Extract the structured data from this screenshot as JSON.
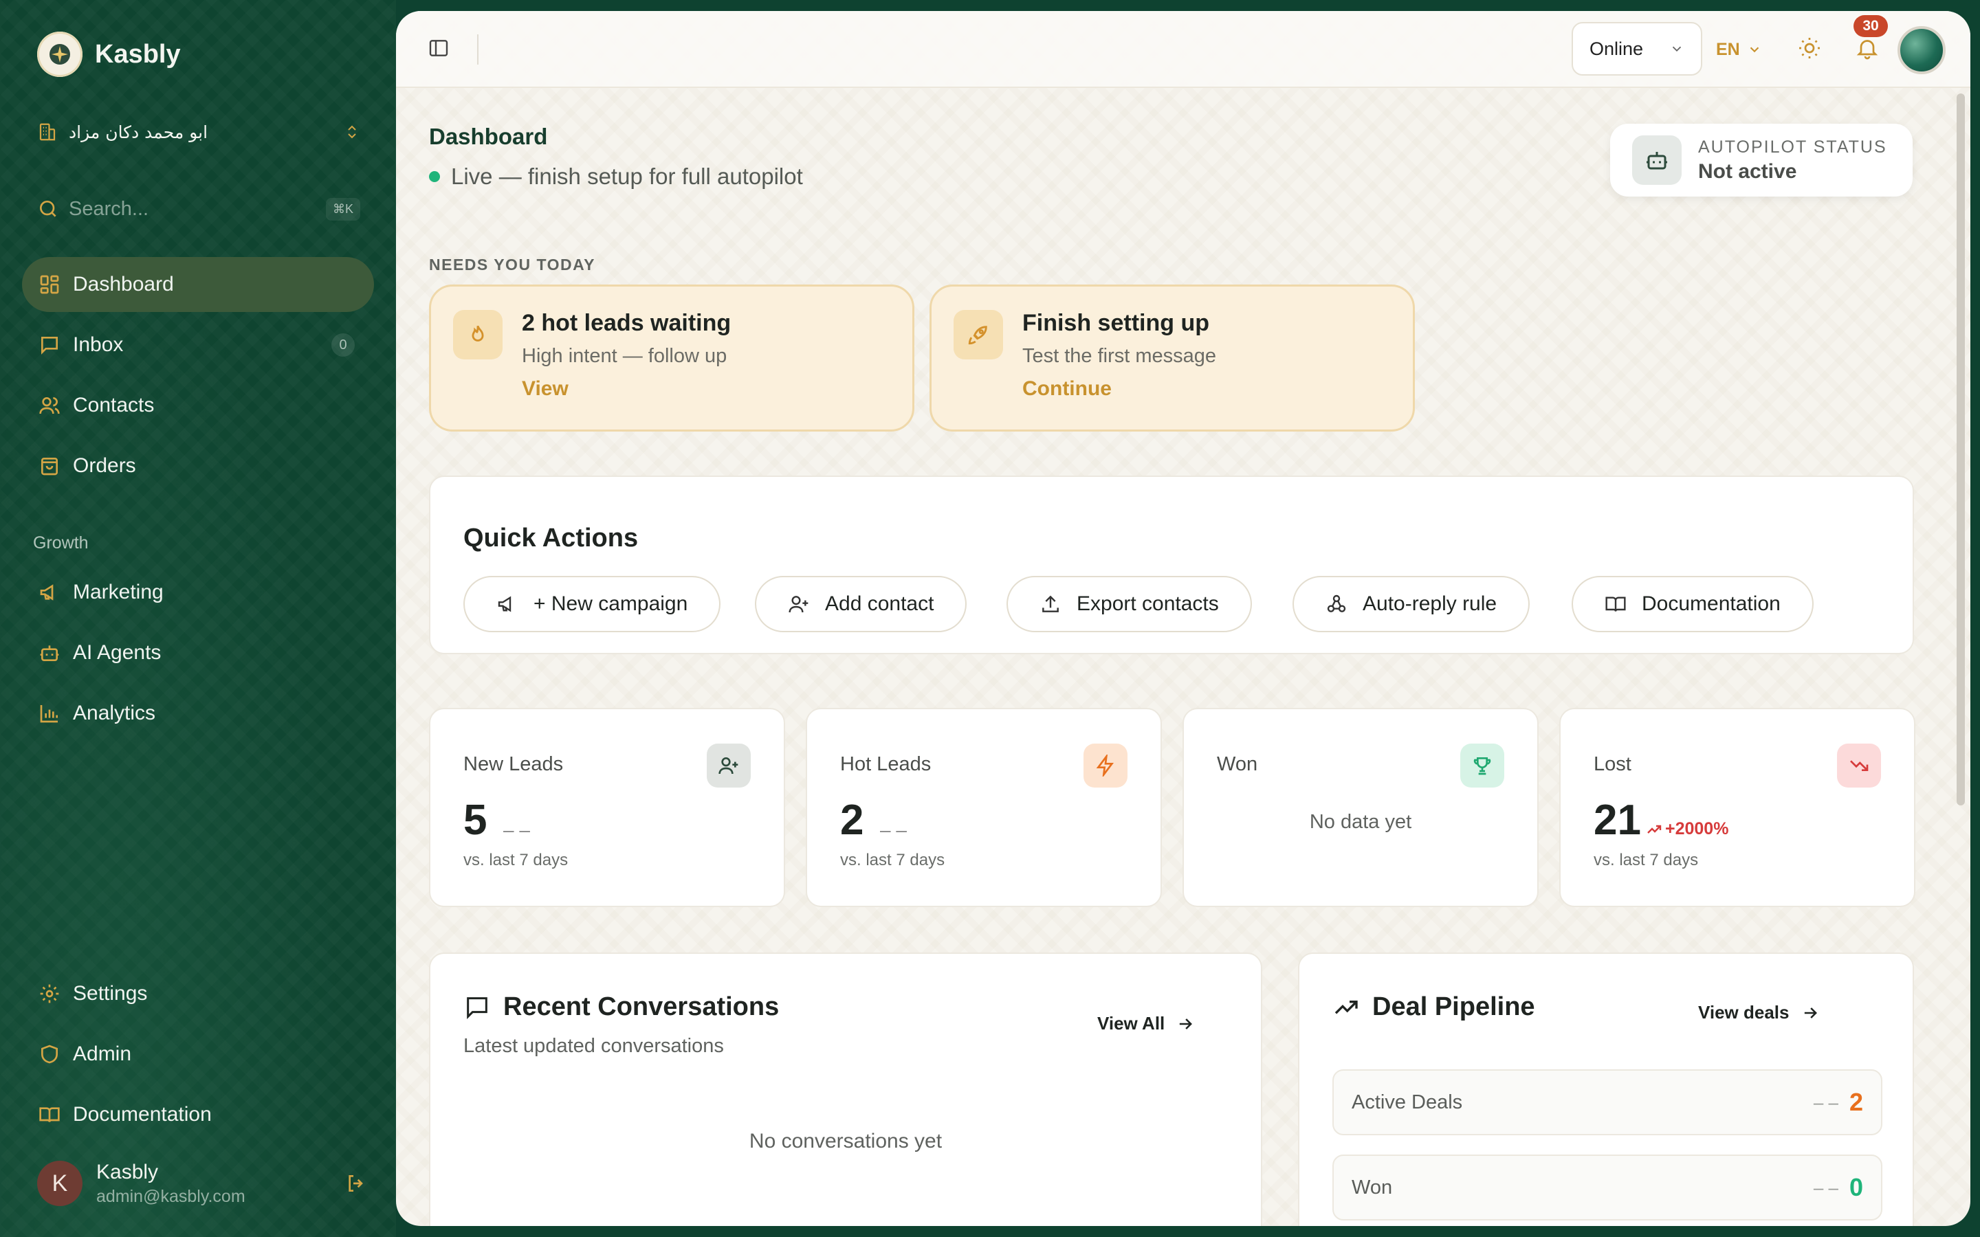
{
  "app": {
    "name": "Kasbly"
  },
  "sidebar": {
    "workspace": "ابو محمد دكان مزاد",
    "search": {
      "placeholder": "Search...",
      "shortcut": "⌘K"
    },
    "items": [
      {
        "label": "Dashboard",
        "icon": "dashboard-icon"
      },
      {
        "label": "Inbox",
        "icon": "inbox-icon",
        "count": "0"
      },
      {
        "label": "Contacts",
        "icon": "contacts-icon"
      },
      {
        "label": "Orders",
        "icon": "orders-icon"
      }
    ],
    "growth_label": "Growth",
    "growth_items": [
      {
        "label": "Marketing",
        "icon": "megaphone-icon"
      },
      {
        "label": "AI Agents",
        "icon": "bot-icon"
      },
      {
        "label": "Analytics",
        "icon": "bar-chart-icon"
      }
    ],
    "bottom_items": [
      {
        "label": "Settings",
        "icon": "gear-icon"
      },
      {
        "label": "Admin",
        "icon": "shield-icon"
      },
      {
        "label": "Documentation",
        "icon": "book-icon"
      }
    ],
    "user": {
      "initial": "K",
      "name": "Kasbly",
      "email": "admin@kasbly.com"
    }
  },
  "topbar": {
    "status": "Online",
    "language": "EN",
    "notifications": "30"
  },
  "header": {
    "title": "Dashboard",
    "live_text": "Live — finish setup for full autopilot",
    "autopilot_label": "AUTOPILOT STATUS",
    "autopilot_value": "Not active"
  },
  "needs": {
    "label": "NEEDS YOU TODAY",
    "cards": [
      {
        "title": "2 hot leads waiting",
        "subtitle": "High intent — follow up",
        "link": "View"
      },
      {
        "title": "Finish setting up",
        "subtitle": "Test the first message",
        "link": "Continue"
      }
    ]
  },
  "quick_actions": {
    "title": "Quick Actions",
    "buttons": [
      {
        "label": "+ New campaign"
      },
      {
        "label": "Add contact"
      },
      {
        "label": "Export contacts"
      },
      {
        "label": "Auto-reply rule"
      },
      {
        "label": "Documentation"
      }
    ]
  },
  "stats": [
    {
      "label": "New Leads",
      "value": "5",
      "trend": "– –",
      "sub": "vs. last 7 days"
    },
    {
      "label": "Hot Leads",
      "value": "2",
      "trend": "– –",
      "sub": "vs. last 7 days"
    },
    {
      "label": "Won",
      "empty": "No data yet"
    },
    {
      "label": "Lost",
      "value": "21",
      "change": "+2000%",
      "sub": "vs. last 7 days"
    }
  ],
  "conversations": {
    "title": "Recent Conversations",
    "subtitle": "Latest updated conversations",
    "view_all": "View All",
    "empty": "No conversations yet"
  },
  "pipeline": {
    "title": "Deal Pipeline",
    "view_deals": "View deals",
    "rows": [
      {
        "label": "Active Deals",
        "dash": "– –",
        "value": "2"
      },
      {
        "label": "Won",
        "dash": "– –",
        "value": "0"
      }
    ]
  },
  "colors": {
    "sidebar": "#0f4430",
    "accent_gold": "#c8922e",
    "danger": "#d63b3b",
    "success": "#1fb47a",
    "warning": "#e8701e"
  }
}
